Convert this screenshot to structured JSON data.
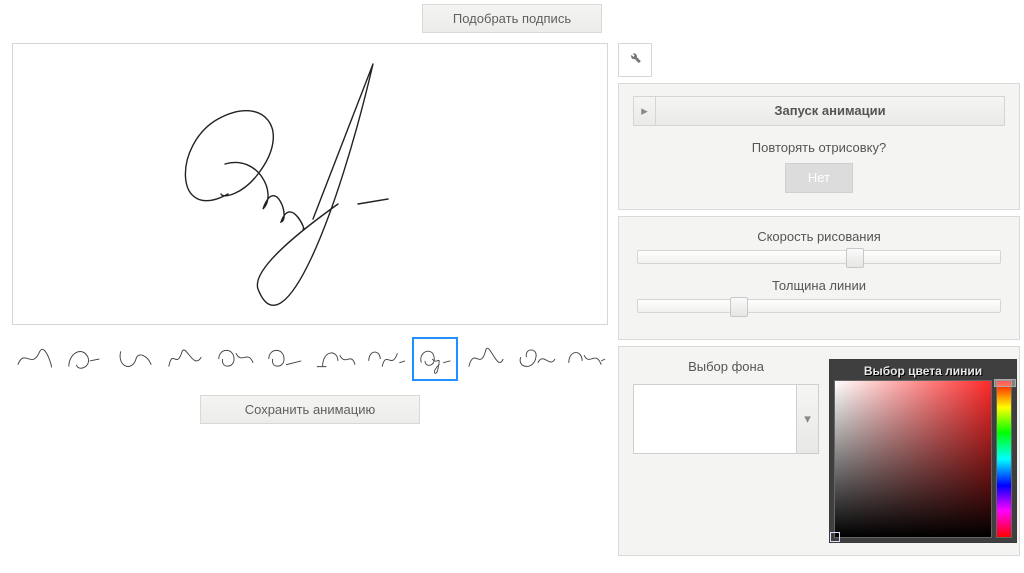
{
  "top_button_label": "Подобрать подпись",
  "save_button_label": "Сохранить анимацию",
  "wrench_icon": "wrench-icon",
  "anim_panel": {
    "play_label": "Запуск анимации",
    "repeat_question": "Повторять отрисовку?",
    "repeat_no_label": "Нет"
  },
  "speed_panel": {
    "speed_label": "Скорость рисования",
    "thickness_label": "Толщина линии",
    "speed_value_pct": 60,
    "thickness_value_pct": 28
  },
  "bg_panel": {
    "bg_label": "Выбор фона",
    "color_title": "Выбор цвета линии"
  },
  "thumbs": [
    {
      "selected": false
    },
    {
      "selected": false
    },
    {
      "selected": false
    },
    {
      "selected": false
    },
    {
      "selected": false
    },
    {
      "selected": false
    },
    {
      "selected": false
    },
    {
      "selected": false
    },
    {
      "selected": true
    },
    {
      "selected": false
    },
    {
      "selected": false
    },
    {
      "selected": false
    }
  ]
}
